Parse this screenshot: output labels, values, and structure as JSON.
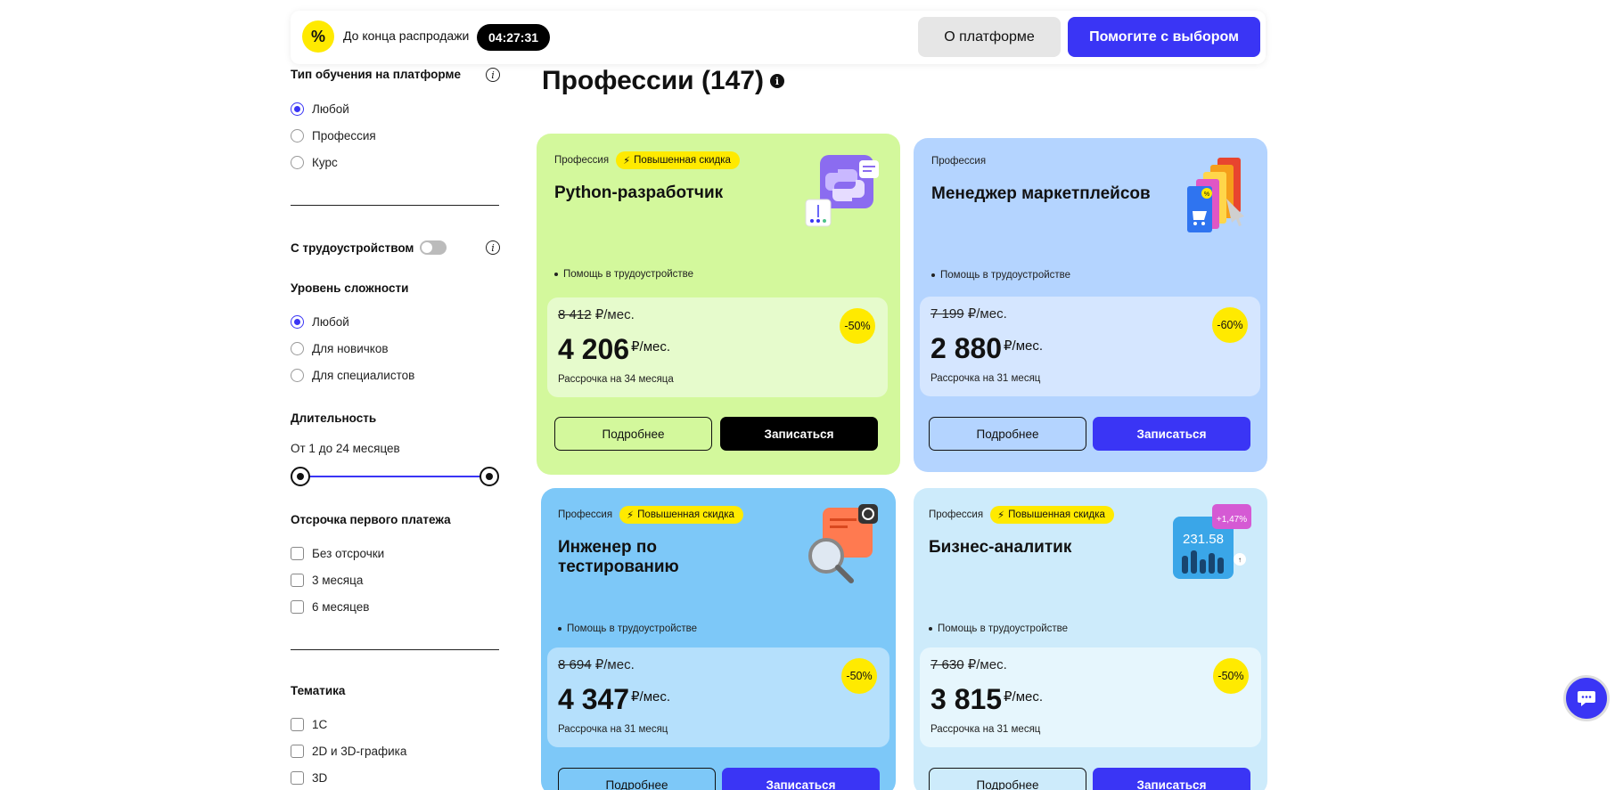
{
  "topbar": {
    "sale_icon": "%",
    "sale_text": "До конца распродажи",
    "timer": "04:27:31",
    "about_label": "О платформе",
    "help_label": "Помогите с выбором"
  },
  "sidebar": {
    "learning_type": {
      "title": "Тип обучения на платформе",
      "options": [
        "Любой",
        "Профессия",
        "Курс"
      ],
      "selected": "Любой"
    },
    "employment_label": "С трудоустройством",
    "employment_on": false,
    "level": {
      "title": "Уровень сложности",
      "options": [
        "Любой",
        "Для новичков",
        "Для специалистов"
      ],
      "selected": "Любой"
    },
    "duration": {
      "title": "Длительность",
      "range_text": "От 1 до 24 месяцев",
      "min": 1,
      "max": 24
    },
    "deferral": {
      "title": "Отсрочка первого платежа",
      "options": [
        "Без отсрочки",
        "3 месяца",
        "6 месяцев"
      ]
    },
    "topic": {
      "title": "Тематика",
      "options": [
        "1С",
        "2D и 3D-графика",
        "3D"
      ]
    }
  },
  "main": {
    "title": "Профессии (147)"
  },
  "cards": [
    {
      "type": "Профессия",
      "badge": "Повышенная скидка",
      "name": "Python-разработчик",
      "perk": "Помощь в трудоустройстве",
      "old_price": "8 412",
      "old_unit": "₽/мес.",
      "new_price": "4 206",
      "new_unit": "₽/мес.",
      "installment": "Рассрочка на 34 месяца",
      "discount": "-50%",
      "more_label": "Подробнее",
      "enroll_label": "Записаться",
      "bg": "#d3f89c",
      "price_bg": "#e6fbcc",
      "enroll_bg": "#000000"
    },
    {
      "type": "Профессия",
      "badge": "",
      "name": "Менеджер маркетплейсов",
      "perk": "Помощь в трудоустройстве",
      "old_price": "7 199",
      "old_unit": "₽/мес.",
      "new_price": "2 880",
      "new_unit": "₽/мес.",
      "installment": "Рассрочка на 31 месяц",
      "discount": "-60%",
      "more_label": "Подробнее",
      "enroll_label": "Записаться",
      "bg": "#b4d4ff",
      "price_bg": "#d5e6ff",
      "enroll_bg": "#3a35f5"
    },
    {
      "type": "Профессия",
      "badge": "Повышенная скидка",
      "name": "Инженер по тестированию",
      "perk": "Помощь в трудоустройстве",
      "old_price": "8 694",
      "old_unit": "₽/мес.",
      "new_price": "4 347",
      "new_unit": "₽/мес.",
      "installment": "Рассрочка на 31 месяц",
      "discount": "-50%",
      "more_label": "Подробнее",
      "enroll_label": "Записаться",
      "bg": "#7dc8f8",
      "price_bg": "#b5e0fc",
      "enroll_bg": "#3a35f5"
    },
    {
      "type": "Профессия",
      "badge": "Повышенная скидка",
      "name": "Бизнес-аналитик",
      "perk": "Помощь в трудоустройстве",
      "old_price": "7 630",
      "old_unit": "₽/мес.",
      "new_price": "3 815",
      "new_unit": "₽/мес.",
      "installment": "Рассрочка на 31 месяц",
      "discount": "-50%",
      "more_label": "Подробнее",
      "enroll_label": "Записаться",
      "bg": "#cdebfb",
      "price_bg": "#e6f6fd",
      "enroll_bg": "#3a35f5"
    }
  ],
  "card_art": {
    "business_value": "231.58",
    "business_delta": "+1,47%"
  }
}
